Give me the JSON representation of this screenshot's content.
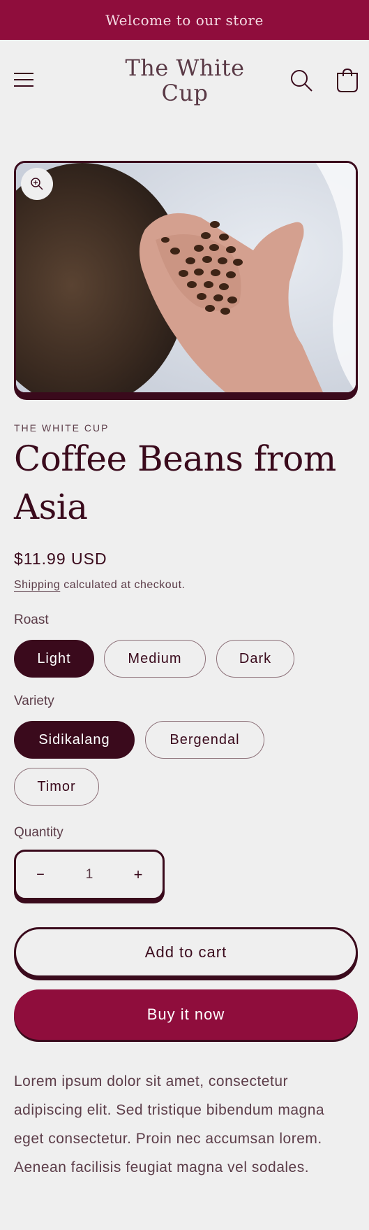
{
  "announcement": {
    "text": "Welcome to our store"
  },
  "header": {
    "logo": "The White\nCup",
    "icons": {
      "menu": "hamburger-menu-icon",
      "search": "search-icon",
      "cart": "shopping-bag-icon"
    }
  },
  "product": {
    "vendor": "THE WHITE CUP",
    "title": "Coffee Beans from Asia",
    "price": "$11.99 USD",
    "shipping_link": "Shipping",
    "shipping_text": " calculated at checkout.",
    "image_icon": "zoom-in-icon",
    "roast": {
      "label": "Roast",
      "options": [
        "Light",
        "Medium",
        "Dark"
      ],
      "selected": "Light"
    },
    "variety": {
      "label": "Variety",
      "options": [
        "Sidikalang",
        "Bergendal",
        "Timor"
      ],
      "selected": "Sidikalang"
    },
    "quantity": {
      "label": "Quantity",
      "value": "1",
      "minus": "−",
      "plus": "+"
    },
    "add_to_cart": "Add to cart",
    "buy_now": "Buy it now",
    "description": "Lorem ipsum dolor sit amet, consectetur adipiscing elit. Sed tristique bibendum magna eget consectetur. Proin nec accumsan lorem. Aenean facilisis feugiat magna vel sodales."
  },
  "colors": {
    "background": "#efefef",
    "accent": "#8f0d3c",
    "text_dark": "#3a0a1c",
    "text_muted": "#5c3d49"
  }
}
